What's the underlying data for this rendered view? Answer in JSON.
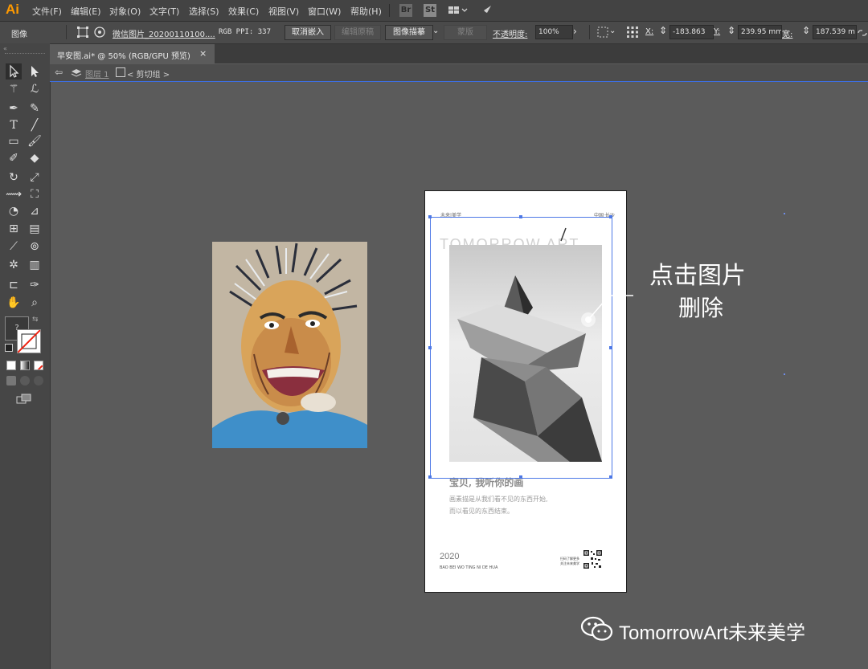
{
  "app": {
    "logo": "Ai"
  },
  "menu": {
    "items": [
      "文件(F)",
      "编辑(E)",
      "对象(O)",
      "文字(T)",
      "选择(S)",
      "效果(C)",
      "视图(V)",
      "窗口(W)",
      "帮助(H)"
    ],
    "br_icon": "Br",
    "st_icon": "St"
  },
  "control": {
    "context_label": "图像",
    "filename": "微信图片_20200110100....",
    "color_info": "RGB  PPI: 337",
    "unembed_btn": "取消嵌入",
    "edit_original_btn": "编辑原稿",
    "image_trace_btn": "图像描摹",
    "mask_btn": "蒙版",
    "opacity_label": "不透明度:",
    "opacity_value": "100%",
    "x_label": "X:",
    "x_value": "-183.863",
    "y_label": "Y:",
    "y_value": "239.95 mm",
    "w_label": "宽:",
    "w_value": "187.539 m"
  },
  "tab": {
    "title": "早安图.ai* @ 50% (RGB/GPU 预览)",
    "close": "×"
  },
  "breadcrumb": {
    "layer": "图层 1",
    "group": "< 剪切组 >"
  },
  "poster": {
    "header_left": "未来|美学",
    "header_right": "中国·长沙",
    "brand": "TOMORROW ART",
    "headline": "宝贝, 我听你的画",
    "body_line1": "画素描是从我们看不见的东西开始,",
    "body_line2": "而以看见的东西结束。",
    "year": "2020",
    "footer": "BAO BEI WO TING NI DE HUA",
    "qr_caption1": "扫码了解更多",
    "qr_caption2": "关注未来美学"
  },
  "callout": {
    "line1": "点击图片",
    "line2": "删除"
  },
  "watermark": {
    "text": "TomorrowArt未来美学"
  },
  "colors": {
    "accent": "#4d78e6",
    "logo": "#ff9a00",
    "canvas": "#5b5b5b"
  }
}
